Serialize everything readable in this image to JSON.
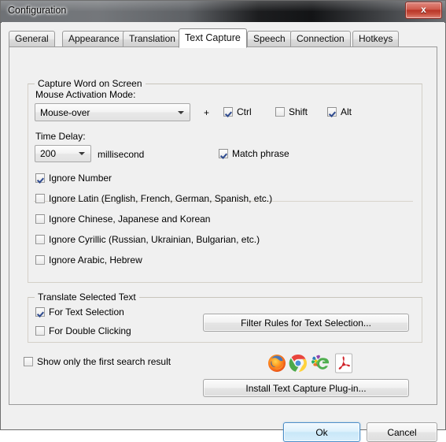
{
  "window": {
    "title": "Configuration",
    "close_label": "x"
  },
  "tabs": [
    {
      "label": "General",
      "active": false
    },
    {
      "label": "Appearance",
      "active": false
    },
    {
      "label": "Translation",
      "active": false
    },
    {
      "label": "Text Capture",
      "active": true
    },
    {
      "label": "Speech",
      "active": false
    },
    {
      "label": "Connection",
      "active": false
    },
    {
      "label": "Hotkeys",
      "active": false
    }
  ],
  "capture_group": {
    "legend": "Capture Word on Screen",
    "mouse_mode_label": "Mouse Activation Mode:",
    "mouse_mode_value": "Mouse-over",
    "plus_sign": "+",
    "modifiers": [
      {
        "label": "Ctrl",
        "checked": true
      },
      {
        "label": "Shift",
        "checked": false
      },
      {
        "label": "Alt",
        "checked": true
      }
    ],
    "time_delay_label": "Time Delay:",
    "time_delay_value": "200",
    "time_delay_unit": "millisecond",
    "match_phrase": {
      "label": "Match phrase",
      "checked": true
    },
    "ignore_options": [
      {
        "label": "Ignore Number",
        "checked": true
      },
      {
        "label": "Ignore Latin (English, French, German, Spanish, etc.)",
        "checked": false
      },
      {
        "label": "Ignore Chinese, Japanese and Korean",
        "checked": false
      },
      {
        "label": "Ignore Cyrillic (Russian, Ukrainian, Bulgarian, etc.)",
        "checked": false
      },
      {
        "label": "Ignore Arabic, Hebrew",
        "checked": false
      }
    ]
  },
  "translate_group": {
    "legend": "Translate Selected Text",
    "for_text_selection": {
      "label": "For Text Selection",
      "checked": true
    },
    "for_double_clicking": {
      "label": "For Double Clicking",
      "checked": false
    },
    "filter_rules_button": "Filter Rules for Text Selection..."
  },
  "bottom": {
    "show_first_result": {
      "label": "Show only the first search result",
      "checked": false
    },
    "install_button": "Install Text Capture Plug-in...",
    "app_icons": [
      "firefox-icon",
      "chrome-icon",
      "internet-explorer-icon",
      "adobe-acrobat-icon"
    ]
  },
  "dialog_buttons": {
    "ok": "Ok",
    "cancel": "Cancel"
  },
  "colors": {
    "dialog_background": "#f0f0f0",
    "tab_active_background": "#ffffff",
    "close_button": "#b83527",
    "default_button_border": "#4b8ec9",
    "checkmark": "#2f4b8f"
  }
}
